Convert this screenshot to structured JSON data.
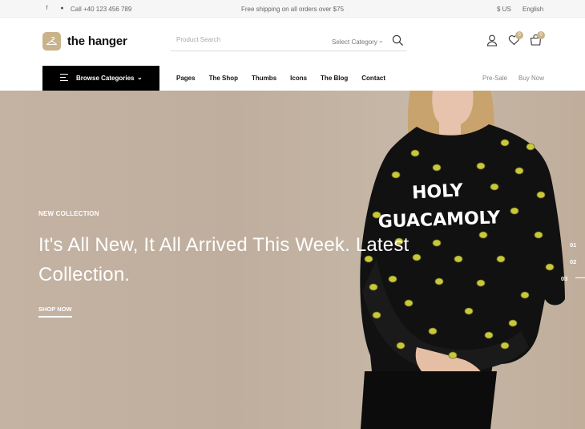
{
  "topbar": {
    "social_icons": [
      "facebook-icon",
      "pinterest-icon"
    ],
    "call": "Call +40 123 456 789",
    "shipping": "Free shipping on all orders over $75",
    "currency": "$ US",
    "language": "English"
  },
  "header": {
    "logo_text": "the hanger",
    "search_placeholder": "Product Search",
    "search_category": "Select Category",
    "wishlist_count": "0",
    "cart_count": "0"
  },
  "nav": {
    "browse_label": "Browse Categories",
    "items": [
      "Pages",
      "The Shop",
      "Thumbs",
      "Icons",
      "The Blog",
      "Contact"
    ],
    "right_items": [
      "Pre-Sale",
      "Buy Now"
    ]
  },
  "hero": {
    "eyebrow": "NEW COLLECTION",
    "headline": "It's All New, It All Arrived This Week. Latest Collection.",
    "cta": "SHOP NOW",
    "slides": [
      "01",
      "02",
      "03"
    ],
    "shirt_text_line1": "HOLY",
    "shirt_text_line2": "GUACAMOLY"
  },
  "colors": {
    "accent": "#c9b38a",
    "hero_bg": "#c2b2a1",
    "nav_dark": "#000000"
  }
}
